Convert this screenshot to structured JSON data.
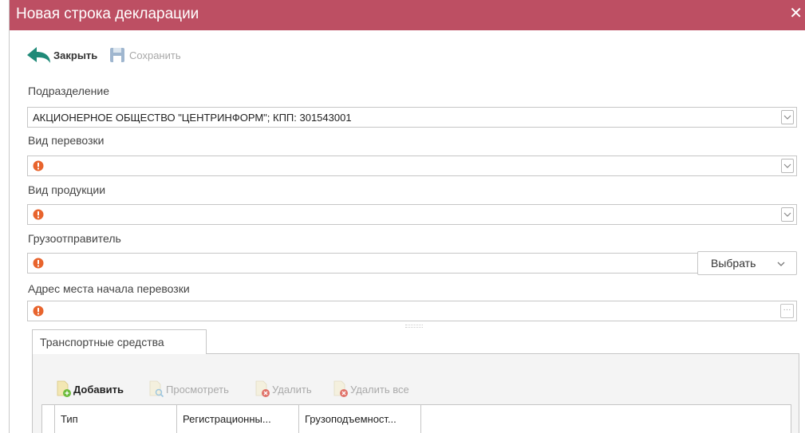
{
  "window": {
    "title": "Новая строка декларации",
    "close_glyph": "✕"
  },
  "toolbar": {
    "close_label": "Закрыть",
    "save_label": "Сохранить"
  },
  "form": {
    "subdivision": {
      "label": "Подразделение",
      "value": "АКЦИОНЕРНОЕ ОБЩЕСТВО \"ЦЕНТРИНФОРМ\"; КПП: 301543001"
    },
    "transport_type": {
      "label": "Вид перевозки",
      "value": ""
    },
    "product_type": {
      "label": "Вид продукции",
      "value": ""
    },
    "shipper": {
      "label": "Грузоотправитель",
      "value": "",
      "select_label": "Выбрать"
    },
    "start_address": {
      "label": "Адрес места начала перевозки",
      "value": "",
      "ellipsis": "···"
    }
  },
  "tabs": [
    {
      "label": "Транспортные средства"
    }
  ],
  "vehicles": {
    "toolbar": {
      "add_label": "Добавить",
      "view_label": "Просмотреть",
      "delete_label": "Удалить",
      "delete_all_label": "Удалить все"
    },
    "columns": [
      "Тип",
      "Регистрационны...",
      "Грузоподъемност..."
    ]
  },
  "icons": [
    "back-arrow-icon",
    "floppy-disk-icon",
    "error-icon",
    "chevron-down-icon",
    "ellipsis-icon",
    "document-add-icon",
    "document-view-icon",
    "document-delete-icon",
    "close-icon"
  ],
  "colors": {
    "titlebar": "#bd4f63",
    "close_arrow": "#1f8a78",
    "error": "#e8642d",
    "add_green": "#6cbc3c",
    "delete_red": "#e0726a"
  }
}
